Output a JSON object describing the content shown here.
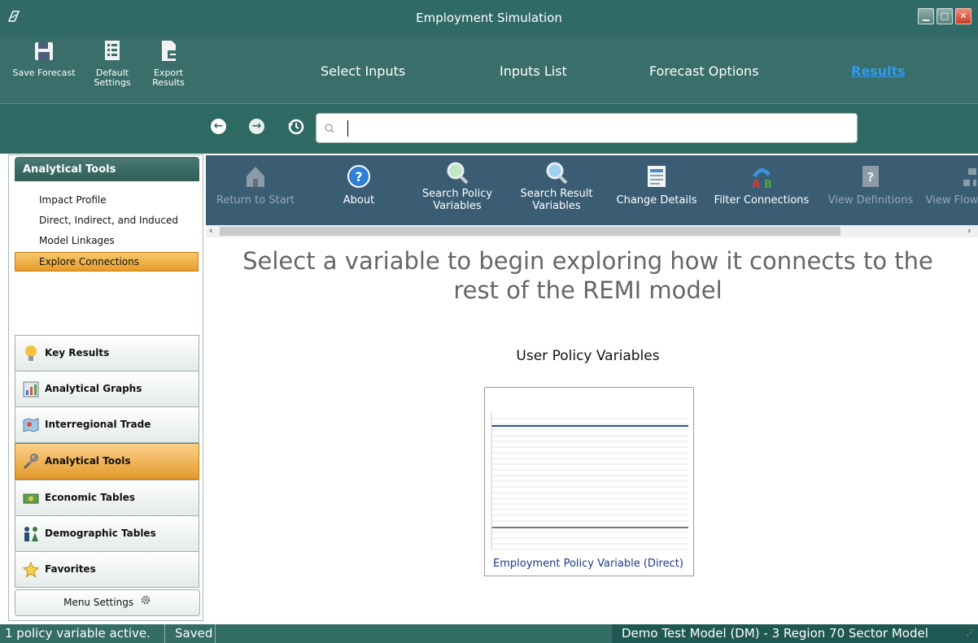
{
  "window": {
    "title": "Employment Simulation"
  },
  "ribbon": {
    "buttons": [
      {
        "label": "Save Forecast",
        "icon": "floppy-icon"
      },
      {
        "label": "Default Settings",
        "icon": "list-icon"
      },
      {
        "label": "Export Results",
        "icon": "export-icon"
      }
    ],
    "tabs": [
      "Select Inputs",
      "Inputs List",
      "Forecast Options",
      "Results"
    ],
    "active_tab": "Results"
  },
  "search": {
    "placeholder": "",
    "value": ""
  },
  "sidebar": {
    "header": "Analytical Tools",
    "items": [
      "Impact Profile",
      "Direct, Indirect, and Induced",
      "Model Linkages",
      "Explore Connections"
    ],
    "selected_item": "Explore Connections",
    "categories": [
      {
        "label": "Key Results",
        "icon": "lightbulb-icon"
      },
      {
        "label": "Analytical Graphs",
        "icon": "graph-icon"
      },
      {
        "label": "Interregional Trade",
        "icon": "map-icon"
      },
      {
        "label": "Analytical Tools",
        "icon": "tools-icon"
      },
      {
        "label": "Economic Tables",
        "icon": "money-icon"
      },
      {
        "label": "Demographic Tables",
        "icon": "people-icon"
      },
      {
        "label": "Favorites",
        "icon": "star-icon"
      }
    ],
    "selected_category": "Analytical Tools",
    "menu_settings": "Menu Settings"
  },
  "toolbar": {
    "items": [
      {
        "label": "Return to Start",
        "enabled": false
      },
      {
        "label": "About",
        "enabled": true
      },
      {
        "label": "Search Policy Variables",
        "enabled": true
      },
      {
        "label": "Search Result Variables",
        "enabled": true
      },
      {
        "label": "Change Details",
        "enabled": true
      },
      {
        "label": "Filter Connections",
        "enabled": true
      },
      {
        "label": "View Definitions",
        "enabled": false
      },
      {
        "label": "View Flow",
        "enabled": false
      }
    ]
  },
  "main": {
    "headline_line1": "Select a variable to begin exploring how it connects to the",
    "headline_line2": "rest of the REMI model",
    "section_title": "User Policy Variables",
    "variable_caption": "Employment Policy Variable (Direct)"
  },
  "status": {
    "left": "1 policy variable active.",
    "middle": "Saved",
    "right": "Demo Test Model (DM) -  3 Region 70 Sector Model"
  },
  "colors": {
    "accent": "#2e9cf2",
    "selected": "#f0a93c",
    "teal": "#2f6a67",
    "toolbar": "#3b5d74"
  }
}
